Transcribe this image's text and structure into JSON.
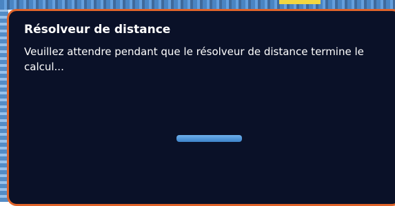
{
  "dialog": {
    "title": "Résolveur de distance",
    "message": "Veuillez attendre pendant que le résolveur de distance termine le calcul...",
    "progress": {
      "state": "indeterminate",
      "fill_fraction": 1.0
    }
  },
  "colors": {
    "dialog_background": "#0a1128",
    "dialog_border": "#e0642a",
    "progress_bar": "#4f95d8",
    "text": "#ffffff"
  }
}
